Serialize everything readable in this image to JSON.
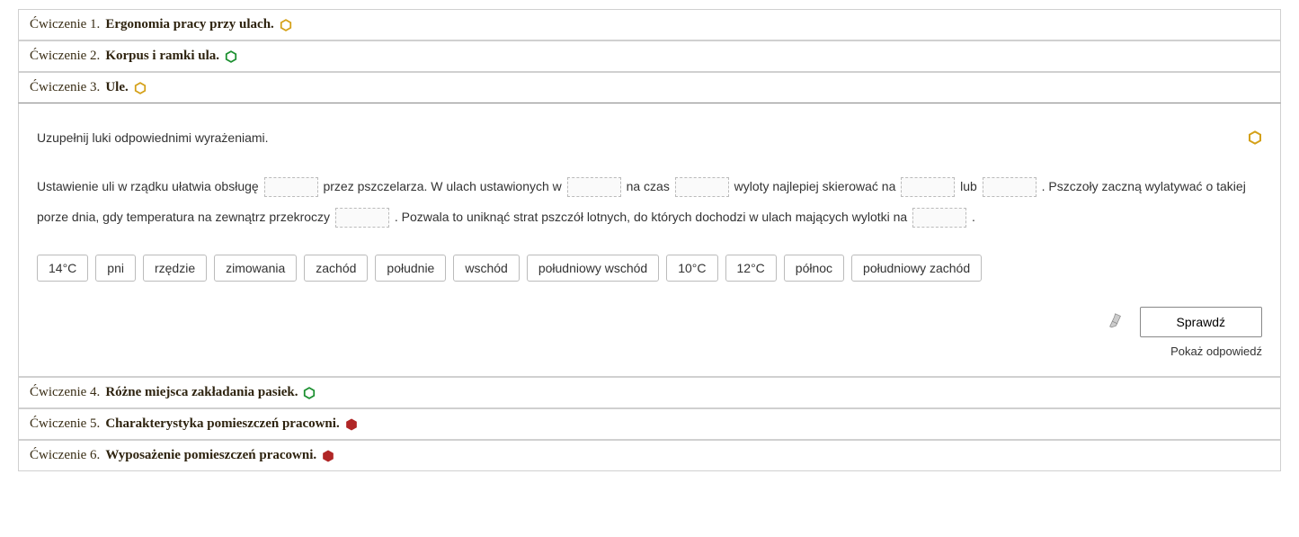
{
  "exercises": [
    {
      "label": "Ćwiczenie 1.",
      "title": "Ergonomia pracy przy ulach.",
      "difficulty": "yellow"
    },
    {
      "label": "Ćwiczenie 2.",
      "title": "Korpus i ramki ula.",
      "difficulty": "green"
    },
    {
      "label": "Ćwiczenie 3.",
      "title": "Ule.",
      "difficulty": "yellow"
    },
    {
      "label": "Ćwiczenie 4.",
      "title": "Różne miejsca zakładania pasiek.",
      "difficulty": "green"
    },
    {
      "label": "Ćwiczenie 5.",
      "title": "Charakterystyka pomieszczeń pracowni.",
      "difficulty": "red"
    },
    {
      "label": "Ćwiczenie 6.",
      "title": "Wyposażenie pomieszczeń pracowni.",
      "difficulty": "red"
    }
  ],
  "active": {
    "instruction": "Uzupełnij luki odpowiednimi wyrażeniami.",
    "text_segments": [
      "Ustawienie uli w rządku ułatwia obsługę ",
      " przez pszczelarza. W ulach ustawionych w ",
      " na czas ",
      " wyloty najlepiej skierować na ",
      " lub ",
      ". Pszczoły zaczną wylatywać o takiej porze dnia, gdy temperatura na zewnątrz przekroczy ",
      ". Pozwala to uniknąć strat pszczół lotnych, do których dochodzi w ulach mających wylotki na ",
      "."
    ],
    "options": [
      "14°C",
      "pni",
      "rzędzie",
      "zimowania",
      "zachód",
      "południe",
      "wschód",
      "południowy wschód",
      "10°C",
      "12°C",
      "północ",
      "południowy zachód"
    ],
    "check_label": "Sprawdź",
    "show_answer_label": "Pokaż odpowiedź"
  },
  "colors": {
    "yellow": "#d4a017",
    "green": "#1a8f2f",
    "red": "#b02626"
  }
}
